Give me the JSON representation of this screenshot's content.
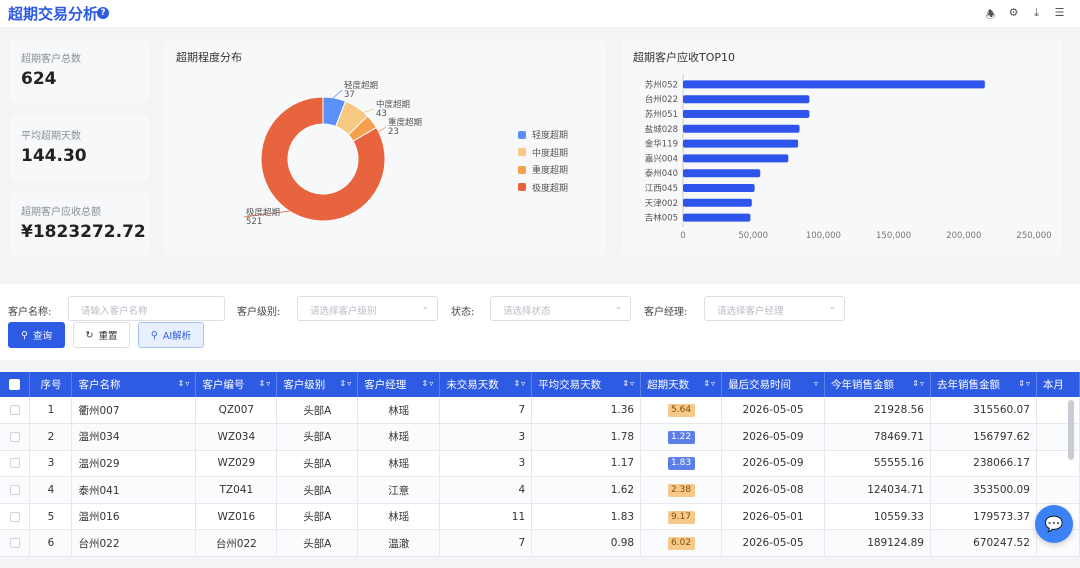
{
  "header": {
    "title": "超期交易分析",
    "help_icon": "question-icon",
    "tools": [
      "bell-icon",
      "gear-icon",
      "download-icon",
      "list-settings-icon"
    ]
  },
  "stats": [
    {
      "label": "超期客户总数",
      "value": "624"
    },
    {
      "label": "平均超期天数",
      "value": "144.30"
    },
    {
      "label": "超期客户应收总额",
      "value": "¥1823272.72"
    }
  ],
  "donut": {
    "title": "超期程度分布",
    "legend": [
      "轻度超期",
      "中度超期",
      "重度超期",
      "极度超期"
    ],
    "labels": [
      {
        "name": "轻度超期",
        "value": "37"
      },
      {
        "name": "中度超期",
        "value": "43"
      },
      {
        "name": "重度超期",
        "value": "23"
      },
      {
        "name": "极度超期",
        "value": "521"
      }
    ],
    "colors": [
      "#5b8ff9",
      "#f6c983",
      "#f4a04d",
      "#e8643f"
    ]
  },
  "bar": {
    "title": "超期客户应收TOP10",
    "ticks": [
      "0",
      "50,000",
      "100,000",
      "150,000",
      "200,000",
      "250,000"
    ]
  },
  "chart_data": [
    {
      "type": "pie",
      "title": "超期程度分布",
      "categories": [
        "轻度超期",
        "中度超期",
        "重度超期",
        "极度超期"
      ],
      "values": [
        37,
        43,
        23,
        521
      ]
    },
    {
      "type": "bar",
      "title": "超期客户应收TOP10",
      "orientation": "horizontal",
      "categories": [
        "苏州052",
        "台州022",
        "苏州051",
        "盐城028",
        "金华119",
        "嘉兴004",
        "泰州040",
        "江西045",
        "天津002",
        "吉林005"
      ],
      "values": [
        215000,
        90000,
        90000,
        83000,
        82000,
        75000,
        55000,
        51000,
        49000,
        48000
      ],
      "xlim": [
        0,
        250000
      ]
    }
  ],
  "filters": {
    "customer_name_label": "客户名称:",
    "customer_name_placeholder": "请输入客户名称",
    "level_label": "客户级别:",
    "level_placeholder": "请选择客户级别",
    "status_label": "状态:",
    "status_placeholder": "请选择状态",
    "manager_label": "客户经理:",
    "manager_placeholder": "请选择客户经理",
    "query_btn": "查询",
    "reset_btn": "重置",
    "ai_btn": "AI解析"
  },
  "table": {
    "headers": [
      "序号",
      "客户名称",
      "客户编号",
      "客户级别",
      "客户经理",
      "未交易天数",
      "平均交易天数",
      "超期天数",
      "最后交易时间",
      "今年销售金额",
      "去年销售金额",
      "本月"
    ],
    "rows": [
      [
        "1",
        "衢州007",
        "QZ007",
        "头部A",
        "林瑶",
        "7",
        "1.36",
        "5.64",
        "2026-05-05",
        "21928.56",
        "315560.07"
      ],
      [
        "2",
        "温州034",
        "WZ034",
        "头部A",
        "林瑶",
        "3",
        "1.78",
        "1.22",
        "2026-05-09",
        "78469.71",
        "156797.62"
      ],
      [
        "3",
        "温州029",
        "WZ029",
        "头部A",
        "林瑶",
        "3",
        "1.17",
        "1.83",
        "2026-05-09",
        "55555.16",
        "238066.17"
      ],
      [
        "4",
        "泰州041",
        "TZ041",
        "头部A",
        "江意",
        "4",
        "1.62",
        "2.38",
        "2026-05-08",
        "124034.71",
        "353500.09"
      ],
      [
        "5",
        "温州016",
        "WZ016",
        "头部A",
        "林瑶",
        "11",
        "1.83",
        "9.17",
        "2026-05-01",
        "10559.33",
        "179573.37"
      ],
      [
        "6",
        "台州022",
        "台州022",
        "头部A",
        "温澈",
        "7",
        "0.98",
        "6.02",
        "2026-05-05",
        "189124.89",
        "670247.52"
      ]
    ],
    "badge_colors": [
      "orange",
      "blue",
      "blue",
      "orange",
      "orange",
      "orange"
    ]
  }
}
